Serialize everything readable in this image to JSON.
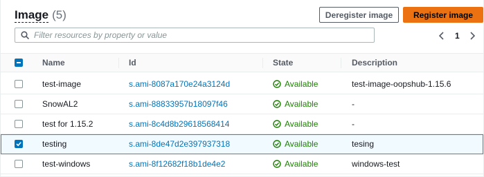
{
  "header": {
    "title": "Image",
    "count": "(5)"
  },
  "actions": {
    "deregister_label": "Deregister image",
    "register_label": "Register image"
  },
  "search": {
    "placeholder": "Filter resources by property or value"
  },
  "pagination": {
    "current_page": "1"
  },
  "table": {
    "columns": [
      "Name",
      "Id",
      "State",
      "Description"
    ],
    "rows": [
      {
        "name": "test-image",
        "id": "s.ami-8087a170e24a3124d",
        "state": "Available",
        "description": "test-image-oopshub-1.15.6",
        "selected": false
      },
      {
        "name": "SnowAL2",
        "id": "s.ami-88833957b18097f46",
        "state": "Available",
        "description": "-",
        "selected": false
      },
      {
        "name": "test for 1.15.2",
        "id": "s.ami-8c4d8b29618568414",
        "state": "Available",
        "description": "-",
        "selected": false
      },
      {
        "name": "testing",
        "id": "s.ami-8de47d2e397937318",
        "state": "Available",
        "description": "tesing",
        "selected": true
      },
      {
        "name": "test-windows",
        "id": "s.ami-8f12682f18b1de4e2",
        "state": "Available",
        "description": "windows-test",
        "selected": false
      }
    ]
  },
  "colors": {
    "primary": "#ec7211",
    "link": "#0073bb",
    "success": "#1d8102",
    "selected_border": "#00a1c9"
  },
  "icons": {
    "search": "search-icon",
    "prev": "chevron-left-icon",
    "next": "chevron-right-icon",
    "status": "check-circle-icon"
  }
}
